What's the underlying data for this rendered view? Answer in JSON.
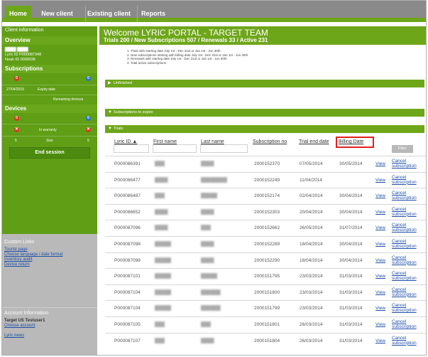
{
  "nav": {
    "tabs": [
      "Home",
      "New client",
      "Existing client",
      "Reports"
    ]
  },
  "sidebar": {
    "client_info_label": "Client information",
    "overview_label": "Overview",
    "client_name": "████ ████",
    "lyric_id": "Lyric ID P000087348",
    "noah_id": "Noah ID 0000036",
    "subscriptions_label": "Subscriptions",
    "subs_red_count": "0",
    "subs_blue_count": "0",
    "expiry_date": "27/04/2015",
    "expiry_label": "Expiry date",
    "remaining_label": "Remaining devices",
    "devices_label": "Devices",
    "dev_red_count": "0",
    "dev_blue_count": "0",
    "in_warranty_label": "In warranty",
    "size_label": "Size",
    "size_left": "5",
    "size_right": "5",
    "end_session_label": "End session",
    "custom_links_label": "Custom Links",
    "custom_links": [
      "Tourist page",
      "Choose language / date format",
      "Inventory audit",
      "Device return"
    ],
    "account_info_label": "Account Information",
    "account_user": "Target US Testuser1",
    "choose_account": "Choose account",
    "lyric_news": "Lyric news"
  },
  "main": {
    "welcome_title": "Welcome LYRIC PORTAL - TARGET TEAM",
    "welcome_sub": "Trials 200 / New Subscriptions 507 / Renewals 33 / Active 231",
    "notes": [
      "1.   Trials with starting date July 1st - Dec 31st or Jan 1st - Jun 30th",
      "2.   New subscriptions starting with billing date July 1st - Dec 31st or Jan 1st - Jun 30th",
      "3.   Renewals with starting date July 1st - Dec 31st or Jan 1st - Jun 30th",
      "4.   Total active subscriptions"
    ],
    "sections": {
      "unfinished": "Unfinished",
      "expire": "Subscriptions to expire",
      "trials": "Trials"
    },
    "table": {
      "headers": [
        "Lyric ID ▲",
        "First name",
        "Last name",
        "Subscription no",
        "Trial end date",
        "Billing Date"
      ],
      "filter_label": "Filter",
      "view_label": "View",
      "cancel_label": "Cancel subscription",
      "rows": [
        [
          "P000086391",
          "███",
          "████",
          "2000152370",
          "07/05/2014",
          "30/05/2014"
        ],
        [
          "P000086477",
          "████",
          "████████",
          "2000152249",
          "11/04/2014",
          ""
        ],
        [
          "P000086487",
          "███",
          "█████",
          "2000152174",
          "02/04/2014",
          "30/04/2014"
        ],
        [
          "P000086652",
          "████",
          "████",
          "2000152303",
          "20/04/2014",
          "30/04/2014"
        ],
        [
          "P000087096",
          "████",
          "███",
          "2000152662",
          "26/05/2014",
          "31/07/2014"
        ],
        [
          "P000087098",
          "█████",
          "████",
          "2000152289",
          "18/04/2014",
          "30/04/2014"
        ],
        [
          "P000087098",
          "█████",
          "████",
          "2000152290",
          "18/04/2014",
          "30/04/2014"
        ],
        [
          "P000087101",
          "█████",
          "█████",
          "2000151795",
          "23/03/2014",
          "31/03/2014"
        ],
        [
          "P000087104",
          "█████",
          "██████",
          "2000151800",
          "23/03/2014",
          "31/03/2014"
        ],
        [
          "P000087104",
          "█████",
          "██████",
          "2000151799",
          "23/03/2014",
          "31/03/2014"
        ],
        [
          "P000087105",
          "███",
          "███",
          "2000151801",
          "26/03/2014",
          "31/03/2014"
        ],
        [
          "P000087107",
          "███",
          "████",
          "2000151804",
          "26/03/2014",
          "31/03/2014"
        ]
      ]
    }
  }
}
